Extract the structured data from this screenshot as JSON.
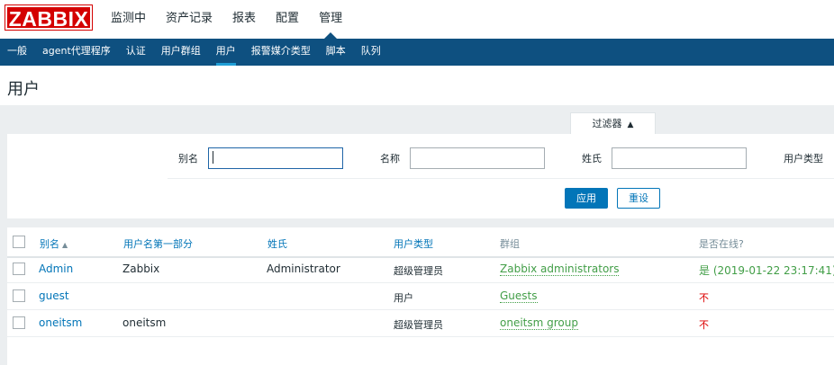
{
  "logo": "ZABBIX",
  "main_nav": [
    "监测中",
    "资产记录",
    "报表",
    "配置",
    "管理"
  ],
  "sub_nav": [
    "一般",
    "agent代理程序",
    "认证",
    "用户群组",
    "用户",
    "报警媒介类型",
    "脚本",
    "队列"
  ],
  "page_title": "用户",
  "filter": {
    "tab_label": "过滤器",
    "alias_label": "别名",
    "name_label": "名称",
    "surname_label": "姓氏",
    "user_type_label": "用户类型",
    "alias_value": "",
    "name_value": "",
    "surname_value": "",
    "apply_label": "应用",
    "reset_label": "重设"
  },
  "table": {
    "headers": {
      "alias": "别名",
      "name": "用户名第一部分",
      "surname": "姓氏",
      "user_type": "用户类型",
      "groups": "群组",
      "online": "是否在线?"
    },
    "rows": [
      {
        "alias": "Admin",
        "name": "Zabbix",
        "surname": "Administrator",
        "user_type": "超级管理员",
        "groups": "Zabbix administrators",
        "online": "是 (2019-01-22 23:17:41)",
        "online_status": "yes"
      },
      {
        "alias": "guest",
        "name": "",
        "surname": "",
        "user_type": "用户",
        "groups": "Guests",
        "online": "不",
        "online_status": "no"
      },
      {
        "alias": "oneitsm",
        "name": "oneitsm",
        "surname": "",
        "user_type": "超级管理员",
        "groups": "oneitsm group",
        "online": "不",
        "online_status": "no"
      }
    ]
  },
  "colors": {
    "brand_red": "#d40000",
    "nav_blue": "#0e5080",
    "link_blue": "#0275b8",
    "ok_green": "#429e47",
    "no_red": "#dc0000"
  }
}
